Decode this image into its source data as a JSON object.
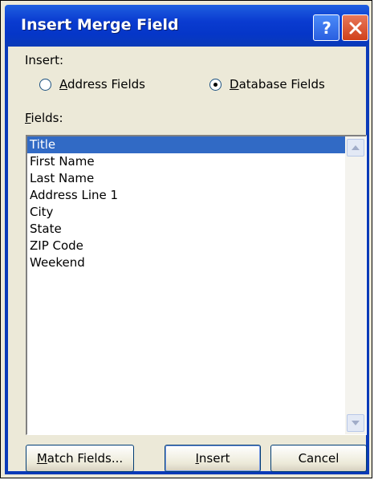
{
  "dialog": {
    "title": "Insert Merge Field",
    "help_icon": "question-mark-icon",
    "close_icon": "close-x-icon"
  },
  "insert": {
    "label": "Insert:",
    "options": [
      {
        "accel": "A",
        "rest": "ddress Fields",
        "selected": false
      },
      {
        "accel": "D",
        "rest": "atabase Fields",
        "selected": true
      }
    ]
  },
  "fields": {
    "label_accel": "F",
    "label_rest": "ields:",
    "items": [
      "Title",
      "First Name",
      "Last Name",
      "Address Line 1",
      "City",
      "State",
      "ZIP Code",
      "Weekend"
    ],
    "selected_index": 0
  },
  "buttons": {
    "match_fields": {
      "accel": "M",
      "rest": "atch Fields..."
    },
    "insert": {
      "accel": "I",
      "rest": "nsert"
    },
    "cancel": "Cancel"
  },
  "colors": {
    "titlebar": "#0a3bd0",
    "selection": "#316ac5",
    "dialog_bg": "#ece9d8"
  }
}
